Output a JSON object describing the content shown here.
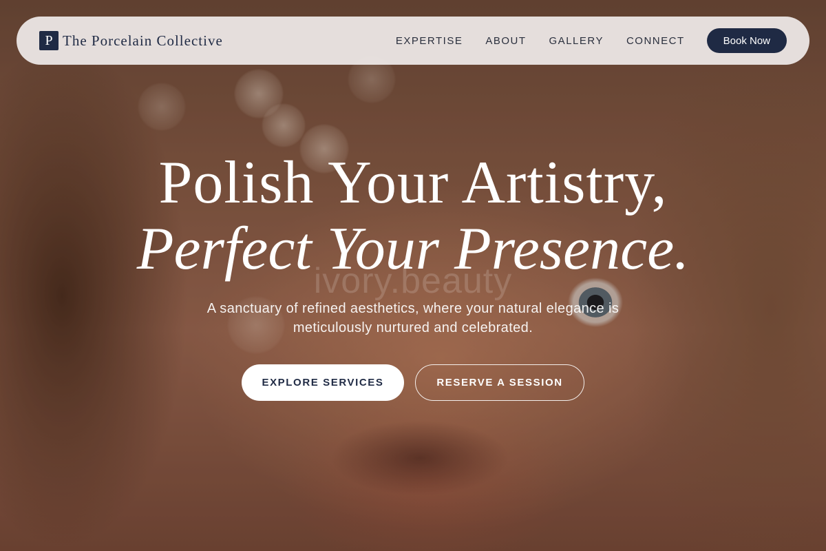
{
  "nav": {
    "brand_mark": "P",
    "brand_name": "The Porcelain Collective",
    "links": [
      "EXPERTISE",
      "ABOUT",
      "GALLERY",
      "CONNECT"
    ],
    "cta_label": "Book Now"
  },
  "hero": {
    "headline_line1": "Polish Your Artistry,",
    "headline_line2": "Perfect Your Presence.",
    "watermark": "ivory.beauty",
    "subtitle": "A sanctuary of refined aesthetics, where your natural elegance is meticulously nurtured and celebrated.",
    "primary_button": "EXPLORE SERVICES",
    "secondary_button": "RESERVE A SESSION"
  },
  "colors": {
    "navy": "#1f2a44",
    "navbar_bg": "#f0ecea",
    "text_light": "#ffffff"
  }
}
